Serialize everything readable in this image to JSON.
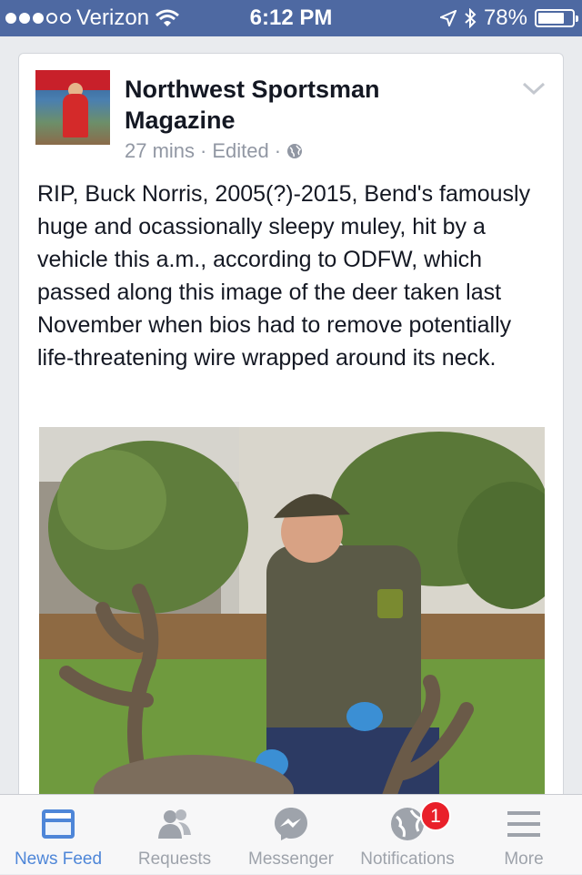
{
  "status": {
    "carrier": "Verizon",
    "time": "6:12 PM",
    "battery": "78%",
    "battery_level": 0.78,
    "signal_bars_filled": 3,
    "signal_bars_total": 5
  },
  "post": {
    "page_name": "Northwest Sportsman Magazine",
    "time_ago": "27 mins",
    "separator": "·",
    "edited": "Edited",
    "text": "RIP, Buck Norris, 2005(?)-2015, Bend's famously huge and ocassionally sleepy muley, hit by a vehicle this a.m., according to ODFW, which passed along this image of the deer taken last  November when bios had to remove potentially life-threatening wire wrapped around its neck.",
    "avatar_icon": "magazine-cover-icon",
    "options_icon": "chevron-down-icon",
    "audience_icon": "globe-icon"
  },
  "tabs": [
    {
      "label": "News Feed",
      "icon": "news-feed-icon",
      "active": true
    },
    {
      "label": "Requests",
      "icon": "friend-requests-icon",
      "active": false
    },
    {
      "label": "Messenger",
      "icon": "messenger-icon",
      "active": false
    },
    {
      "label": "Notifications",
      "icon": "globe-notifications-icon",
      "active": false,
      "badge": "1"
    },
    {
      "label": "More",
      "icon": "menu-icon",
      "active": false
    }
  ],
  "colors": {
    "status_bar": "#4e69a2",
    "active_tab": "#4e86d8",
    "inactive_tab": "#9ea3ab",
    "badge": "#e9202a"
  }
}
